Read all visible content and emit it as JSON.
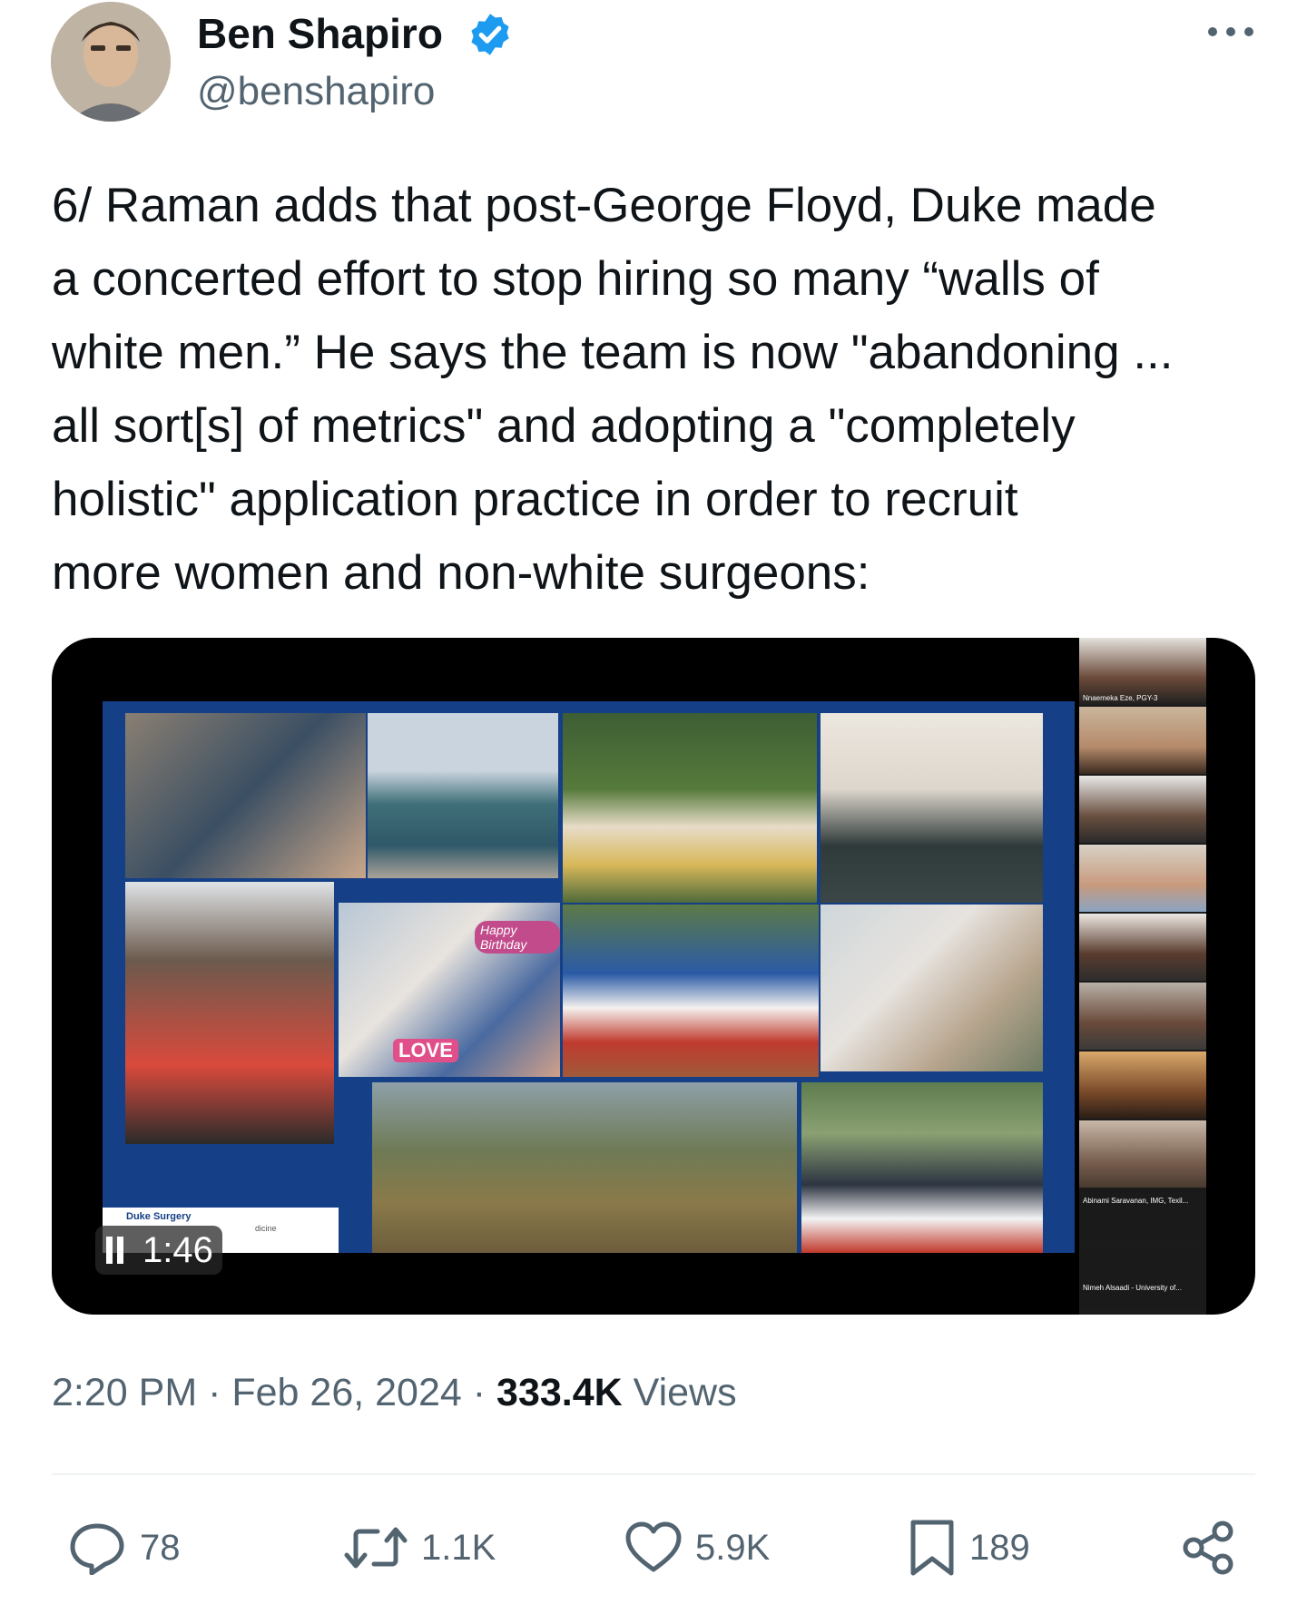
{
  "author": {
    "name": "Ben Shapiro",
    "handle": "@benshapiro",
    "verified": true,
    "verified_color": "#1d9bf0"
  },
  "tweet": {
    "lines": [
      "6/ Raman adds that post-George Floyd, Duke made",
      "a concerted effort to stop hiring so many “walls of",
      "white men.” He says the team is now \"abandoning ...",
      "all sort[s] of metrics\" and adopting a \"completely",
      "holistic\" application practice in order to recruit",
      "more women and non-white surgeons:"
    ]
  },
  "media": {
    "type": "video",
    "state": "playing",
    "elapsed": "1:46",
    "slide_logo_text": "Duke Surgery",
    "slide_logo_sub": "dicine",
    "photo_texts": [
      "LOVE",
      "Happy Birthday"
    ],
    "participants": [
      "Nnaemeka Eze, PGY-3",
      "Abinami Saravanan, IMG, Texil...",
      "Nimeh Alsaadi - University of..."
    ]
  },
  "meta": {
    "time": "2:20 PM",
    "separator": "·",
    "date": "Feb 26, 2024",
    "views_count": "333.4K",
    "views_label": "Views"
  },
  "actions": {
    "replies": "78",
    "reposts": "1.1K",
    "likes": "5.9K",
    "bookmarks": "189"
  },
  "colors": {
    "text": "#0f1419",
    "secondary": "#536471",
    "slide_blue": "#153f86"
  }
}
